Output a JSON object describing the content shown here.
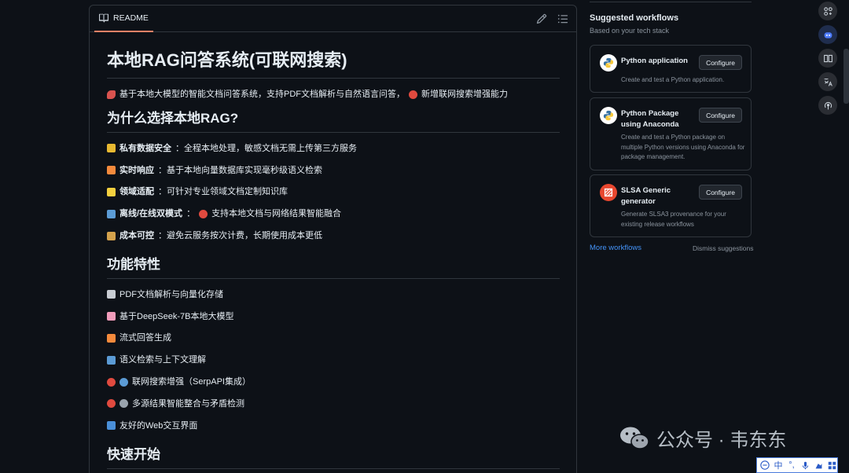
{
  "readme": {
    "tab_label": "README",
    "title": "本地RAG问答系统(可联网搜索)",
    "intro": "基于本地大模型的智能文档问答系统，支持PDF文档解析与自然语言问答，",
    "intro_tail": "新增联网搜索增强能力",
    "section_why": "为什么选择本地RAG?",
    "why_items": [
      {
        "bold": "私有数据安全",
        "text": "：全程本地处理，敏感文档无需上传第三方服务",
        "emoji": "lock",
        "color": "#e8b931"
      },
      {
        "bold": "实时响应",
        "text": "：基于本地向量数据库实现毫秒级语义检索",
        "emoji": "lightning",
        "color": "#f58a3c"
      },
      {
        "bold": "领域适配",
        "text": "：可针对专业领域文档定制知识库",
        "emoji": "bulb",
        "color": "#f4d03f"
      },
      {
        "bold": "离线/在线双模式",
        "text": "：",
        "tail": "支持本地文档与网络结果智能融合",
        "emoji": "globe",
        "color": "#5b9bd5"
      },
      {
        "bold": "成本可控",
        "text": "：避免云服务按次计费，长期使用成本更低",
        "emoji": "moneybag",
        "color": "#d4a24c"
      }
    ],
    "section_features": "功能特性",
    "feature_items": [
      {
        "text": "PDF文档解析与向量化存储",
        "emoji": "page",
        "color": "#c8ccd2"
      },
      {
        "text": "基于DeepSeek-7B本地大模型",
        "emoji": "brain",
        "color": "#f19cbb"
      },
      {
        "text": "流式回答生成",
        "emoji": "lightning",
        "color": "#f58a3c"
      },
      {
        "text": "语义检索与上下文理解",
        "emoji": "magnifier",
        "color": "#5b9bd5"
      },
      {
        "text": "联网搜索增强（SerpAPI集成）",
        "emoji": "target-globe",
        "color": "#e04a3f"
      },
      {
        "text": "多源结果智能整合与矛盾检测",
        "emoji": "target-link",
        "color": "#e04a3f"
      },
      {
        "text": "友好的Web交互界面",
        "emoji": "computer",
        "color": "#4a8fd8"
      }
    ],
    "section_quickstart": "快速开始"
  },
  "suggested": {
    "title": "Suggested workflows",
    "subtitle": "Based on your tech stack",
    "workflows": [
      {
        "name": "Python application",
        "desc": "Create and test a Python application.",
        "button": "Configure",
        "icon": "python-icon"
      },
      {
        "name": "Python Package using Anaconda",
        "desc": "Create and test a Python package on multiple Python versions using Anaconda for package management.",
        "button": "Configure",
        "icon": "python-icon"
      },
      {
        "name": "SLSA Generic generator",
        "desc": "Generate SLSA3 provenance for your existing release workflows",
        "button": "Configure",
        "icon": "slsa-icon"
      }
    ],
    "more_link": "More workflows",
    "dismiss_link": "Dismiss suggestions"
  },
  "watermark": {
    "text": "公众号 · 韦东东"
  },
  "ime": {
    "mode": "中",
    "punct": "°,"
  }
}
